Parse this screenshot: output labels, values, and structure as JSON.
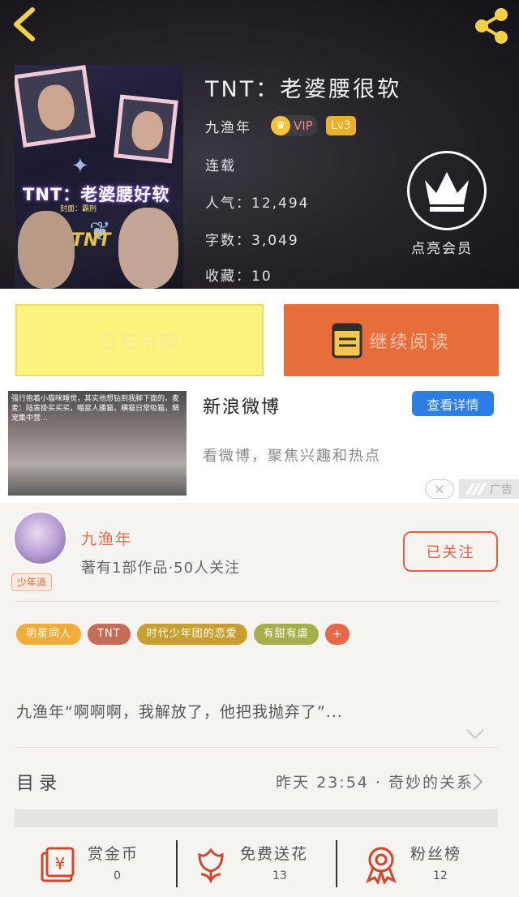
{
  "header": {
    "back_icon": "chevron-left-icon",
    "share_icon": "share-icon"
  },
  "cover": {
    "title": "TNT：老婆腰好软",
    "subtitle": "封面：霸刑",
    "logo": "TNT"
  },
  "book": {
    "title": "TNT：老婆腰很软",
    "author": "九渔年",
    "vip_label": "VIP",
    "level_label": "Lv3",
    "status": "连载",
    "popularity_line": "人气：12,494",
    "word_count_line": "字数：3,049",
    "favorites_line": "收藏：10",
    "vip_action_label": "点亮会员"
  },
  "actions": {
    "shelf_label": "已在书架",
    "read_label": "继续阅读"
  },
  "ad": {
    "image_text": "强行抱着小猫咪睡觉，其实他想钻到我脚下面的，麦麦：陆害掛买买买，喵星人播猫，横猫日常吸猫，萌宠集中营...",
    "title": "新浪微博",
    "description": "看微博，聚焦兴趣和热点",
    "detail_button": "查看详情",
    "close_symbol": "✕",
    "tag": "广告"
  },
  "author_section": {
    "name": "九渔年",
    "stats": "著有1部作品·50人关注",
    "badge": "少年派",
    "follow_label": "已关注",
    "tags": [
      {
        "label": "明星同人",
        "color": "#f1ad37"
      },
      {
        "label": "TNT",
        "color": "#c46c55"
      },
      {
        "label": "时代少年团的恋爱",
        "color": "#c9a030"
      },
      {
        "label": "有甜有虐",
        "color": "#a5b04a"
      }
    ],
    "add_tag_symbol": "+",
    "excerpt": "九渔年“啊啊啊，我解放了，他把我抛弃了”...",
    "toc_label": "目录",
    "toc_latest": "昨天 23:54 · 奇妙的关系"
  },
  "bottom_bar": {
    "items": [
      {
        "label": "赏金币",
        "value": "0",
        "icon": "red-envelope-yen-icon"
      },
      {
        "label": "免费送花",
        "value": "13",
        "icon": "flower-icon"
      },
      {
        "label": "粉丝榜",
        "value": "12",
        "icon": "medal-ribbon-icon"
      }
    ]
  },
  "colors": {
    "accent_orange": "#e96d3a",
    "shelf_yellow": "#fbf47e",
    "follow_red": "#e25e45",
    "header_yellow_icon": "#f4d046"
  }
}
